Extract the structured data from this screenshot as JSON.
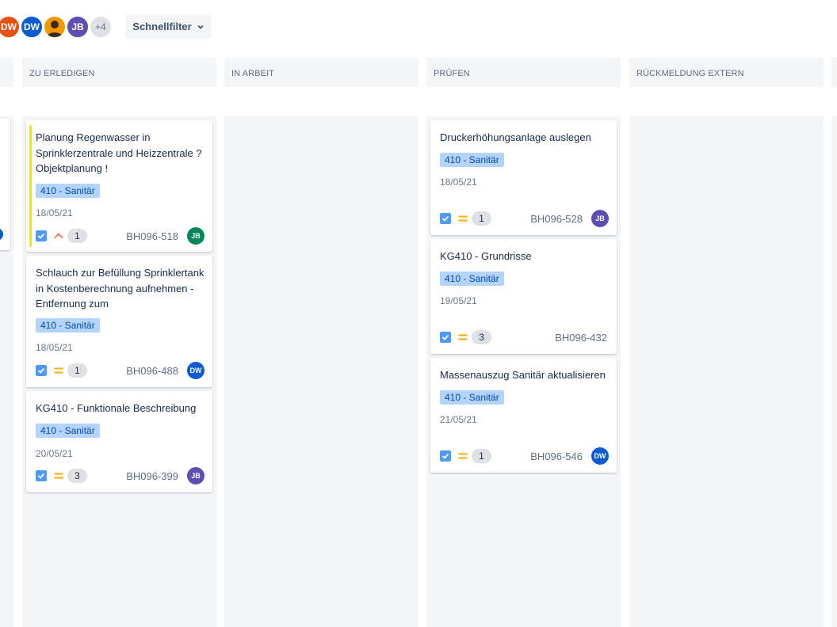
{
  "filters": {
    "avatars": [
      {
        "initials": "DW",
        "color": "#e8500f"
      },
      {
        "initials": "DW",
        "color": "#0b5cd0"
      },
      {
        "initials": "",
        "color": "#f29900",
        "icon": "person-icon"
      },
      {
        "initials": "JB",
        "color": "#5e4db2"
      }
    ],
    "more_label": "+4",
    "quickfilter_label": "Schnellfilter"
  },
  "columns": [
    {
      "title": "ZU ERLEDIGEN"
    },
    {
      "title": "IN ARBEIT"
    },
    {
      "title": "PRÜFEN"
    },
    {
      "title": "RÜCKMELDUNG EXTERN"
    }
  ],
  "cards": {
    "todo": [
      {
        "title": "Planung Regenwasser in Sprinklerzentrale und Heizzentrale ? Objektplanung !",
        "tag": "410 - Sanitär",
        "date": "18/05/21",
        "priority": "high",
        "count": "1",
        "key": "BH096-518",
        "assignee": "JB",
        "flagged": true
      },
      {
        "title": "Schlauch zur Befüllung Sprinklertank in Kostenberechnung aufnehmen - Entfernung zum",
        "tag": "410 - Sanitär",
        "date": "18/05/21",
        "priority": "medium",
        "count": "1",
        "key": "BH096-488",
        "assignee": "DW"
      },
      {
        "title": "KG410 - Funktionale Beschreibung",
        "tag": "410 - Sanitär",
        "date": "20/05/21",
        "priority": "medium",
        "count": "3",
        "key": "BH096-399",
        "assignee": "JB"
      }
    ],
    "review": [
      {
        "title": "Druckerhöhungsanlage auslegen",
        "tag": "410 - Sanitär",
        "date": "18/05/21",
        "priority": "medium",
        "count": "1",
        "key": "BH096-528",
        "assignee": "JB"
      },
      {
        "title": "KG410 - Grundrisse",
        "tag": "410 - Sanitär",
        "date": "19/05/21",
        "priority": "medium",
        "count": "3",
        "key": "BH096-432",
        "assignee": ""
      },
      {
        "title": "Massenauszug Sanitär aktualisieren",
        "tag": "410 - Sanitär",
        "date": "21/05/21",
        "priority": "medium",
        "count": "1",
        "key": "BH096-546",
        "assignee": "DW"
      }
    ]
  },
  "colors": {
    "column_bg": "#f4f5f7",
    "tag_bg": "#b3d4ff",
    "tag_text": "#0747a6",
    "priority_medium": "#ffab00",
    "priority_high": "#ff7452",
    "flag": "#f4e02a"
  }
}
